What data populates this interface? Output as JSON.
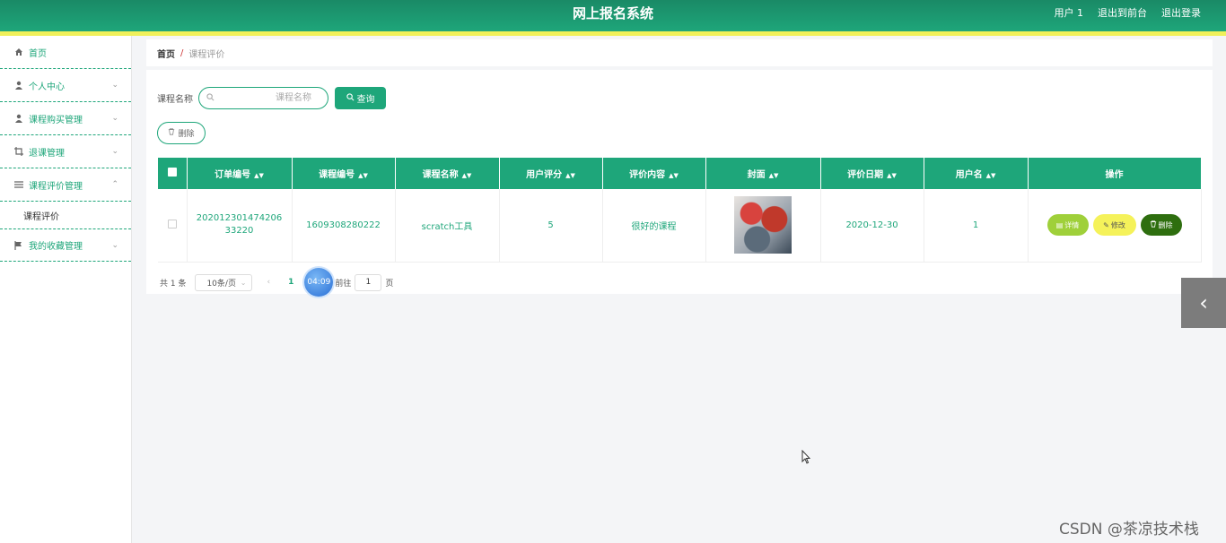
{
  "header": {
    "title": "网上报名系统",
    "user": "用户 1",
    "back_front": "退出到前台",
    "logout": "退出登录"
  },
  "sidebar": {
    "items": [
      {
        "label": "首页",
        "icon": "home-icon"
      },
      {
        "label": "个人中心",
        "icon": "user-icon"
      },
      {
        "label": "课程购买管理",
        "icon": "user-icon"
      },
      {
        "label": "退课管理",
        "icon": "crop-icon"
      },
      {
        "label": "课程评价管理",
        "icon": "menu-icon"
      },
      {
        "label": "我的收藏管理",
        "icon": "flag-icon"
      }
    ],
    "sub_item": "课程评价"
  },
  "breadcrumb": {
    "home": "首页",
    "separator": "/",
    "current": "课程评价"
  },
  "search": {
    "label": "课程名称",
    "placeholder": "课程名称",
    "query_button": "查询"
  },
  "delete_button": "删除",
  "table": {
    "headers": [
      "订单编号",
      "课程编号",
      "课程名称",
      "用户评分",
      "评价内容",
      "封面",
      "评价日期",
      "用户名",
      "操作"
    ],
    "rows": [
      {
        "order_no": "20201230147420633220",
        "course_no": "1609308280222",
        "course_name": "scratch工具",
        "score": "5",
        "content": "很好的课程",
        "date": "2020-12-30",
        "username": "1"
      }
    ],
    "actions": {
      "detail": "详情",
      "edit": "修改",
      "delete": "删除"
    }
  },
  "pager": {
    "total": "共 1 条",
    "page_size": "10条/页",
    "current_page": "1",
    "timer": "04:09",
    "goto_label": "前往",
    "goto_value": "1",
    "page_unit": "页"
  },
  "watermark": "CSDN @茶凉技术栈",
  "colors": {
    "primary": "#1ea67a",
    "accent_line": "#f0f05a",
    "detail_btn": "#9fd03a",
    "edit_btn": "#f5f25a",
    "delete_btn": "#2e6e0f"
  }
}
